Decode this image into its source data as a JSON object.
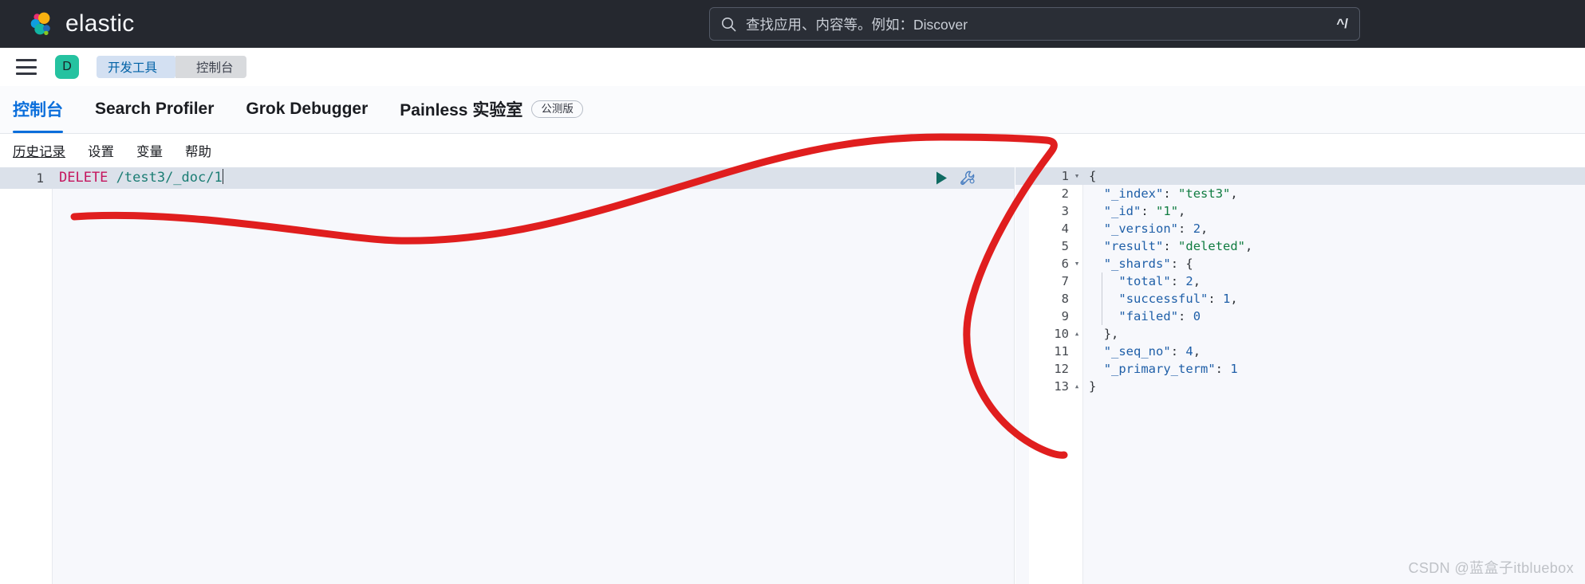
{
  "header": {
    "brand": "elastic",
    "logo_icon": "elastic-logo-icon",
    "search": {
      "icon": "search-icon",
      "placeholder": "查找应用、内容等。例如：Discover",
      "value": "",
      "shortcut": "^/"
    }
  },
  "breadcrumb": {
    "menu_icon": "hamburger-menu-icon",
    "avatar_initial": "D",
    "items": [
      {
        "label": "开发工具"
      },
      {
        "label": "控制台"
      }
    ]
  },
  "tabs": [
    {
      "label": "控制台",
      "active": true
    },
    {
      "label": "Search Profiler",
      "active": false
    },
    {
      "label": "Grok Debugger",
      "active": false
    },
    {
      "label": "Painless 实验室",
      "active": false,
      "badge": "公测版"
    }
  ],
  "submenu": [
    {
      "label": "历史记录"
    },
    {
      "label": "设置"
    },
    {
      "label": "变量"
    },
    {
      "label": "帮助"
    }
  ],
  "editor": {
    "line_number": "1",
    "method": "DELETE",
    "path": " /test3/_doc/1",
    "play_icon": "play-run-icon",
    "wrench_icon": "wrench-settings-icon"
  },
  "response": {
    "lines": [
      {
        "num": "1",
        "fold": "▾",
        "text": "{"
      },
      {
        "num": "2",
        "fold": "",
        "text": "  \"_index\": \"test3\","
      },
      {
        "num": "3",
        "fold": "",
        "text": "  \"_id\": \"1\","
      },
      {
        "num": "4",
        "fold": "",
        "text": "  \"_version\": 2,"
      },
      {
        "num": "5",
        "fold": "",
        "text": "  \"result\": \"deleted\","
      },
      {
        "num": "6",
        "fold": "▾",
        "text": "  \"_shards\": {"
      },
      {
        "num": "7",
        "fold": "",
        "text": "    \"total\": 2,"
      },
      {
        "num": "8",
        "fold": "",
        "text": "    \"successful\": 1,"
      },
      {
        "num": "9",
        "fold": "",
        "text": "    \"failed\": 0"
      },
      {
        "num": "10",
        "fold": "▴",
        "text": "  },"
      },
      {
        "num": "11",
        "fold": "",
        "text": "  \"_seq_no\": 4,"
      },
      {
        "num": "12",
        "fold": "",
        "text": "  \"_primary_term\": 1"
      },
      {
        "num": "13",
        "fold": "▴",
        "text": "}"
      }
    ]
  },
  "annotation": {
    "color": "#e01e1e",
    "shape": "hand-drawn-arrow-curve"
  },
  "watermark": "CSDN @蓝盒子itbluebox",
  "colors": {
    "topbar_bg": "#25282f",
    "accent_blue": "#0a6edb",
    "avatar_teal": "#25c2a0",
    "method_pink": "#c5155e",
    "url_teal": "#1b7d74",
    "json_string_green": "#107c41",
    "json_key_blue": "#1f5fa8"
  }
}
